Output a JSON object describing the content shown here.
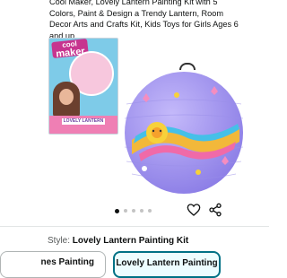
{
  "product": {
    "title_lines": [
      "Cool Maker, Lovely Lantern Painting Kit with 5",
      "Colors, Paint & Design a Trendy Lantern, Room",
      "Decor Arts and Crafts Kit, Kids Toys for Girls Ages 6",
      "and up"
    ]
  },
  "box_art": {
    "brand_top": "cool",
    "brand_main": "maker",
    "label": "LOVELY LANTERN"
  },
  "carousel": {
    "dot_count": 5,
    "active_index": 0
  },
  "icons": {
    "favorite": "heart-icon",
    "share": "share-icon"
  },
  "style_selector": {
    "label": "Style:",
    "selected_value": "Lovely Lantern Painting Kit",
    "options": [
      {
        "label": "nes Painting"
      },
      {
        "label": "Lovely Lantern Painting"
      }
    ]
  },
  "colors": {
    "selected_border": "#007185",
    "text": "#0f1111",
    "lantern": "#a79af0"
  }
}
